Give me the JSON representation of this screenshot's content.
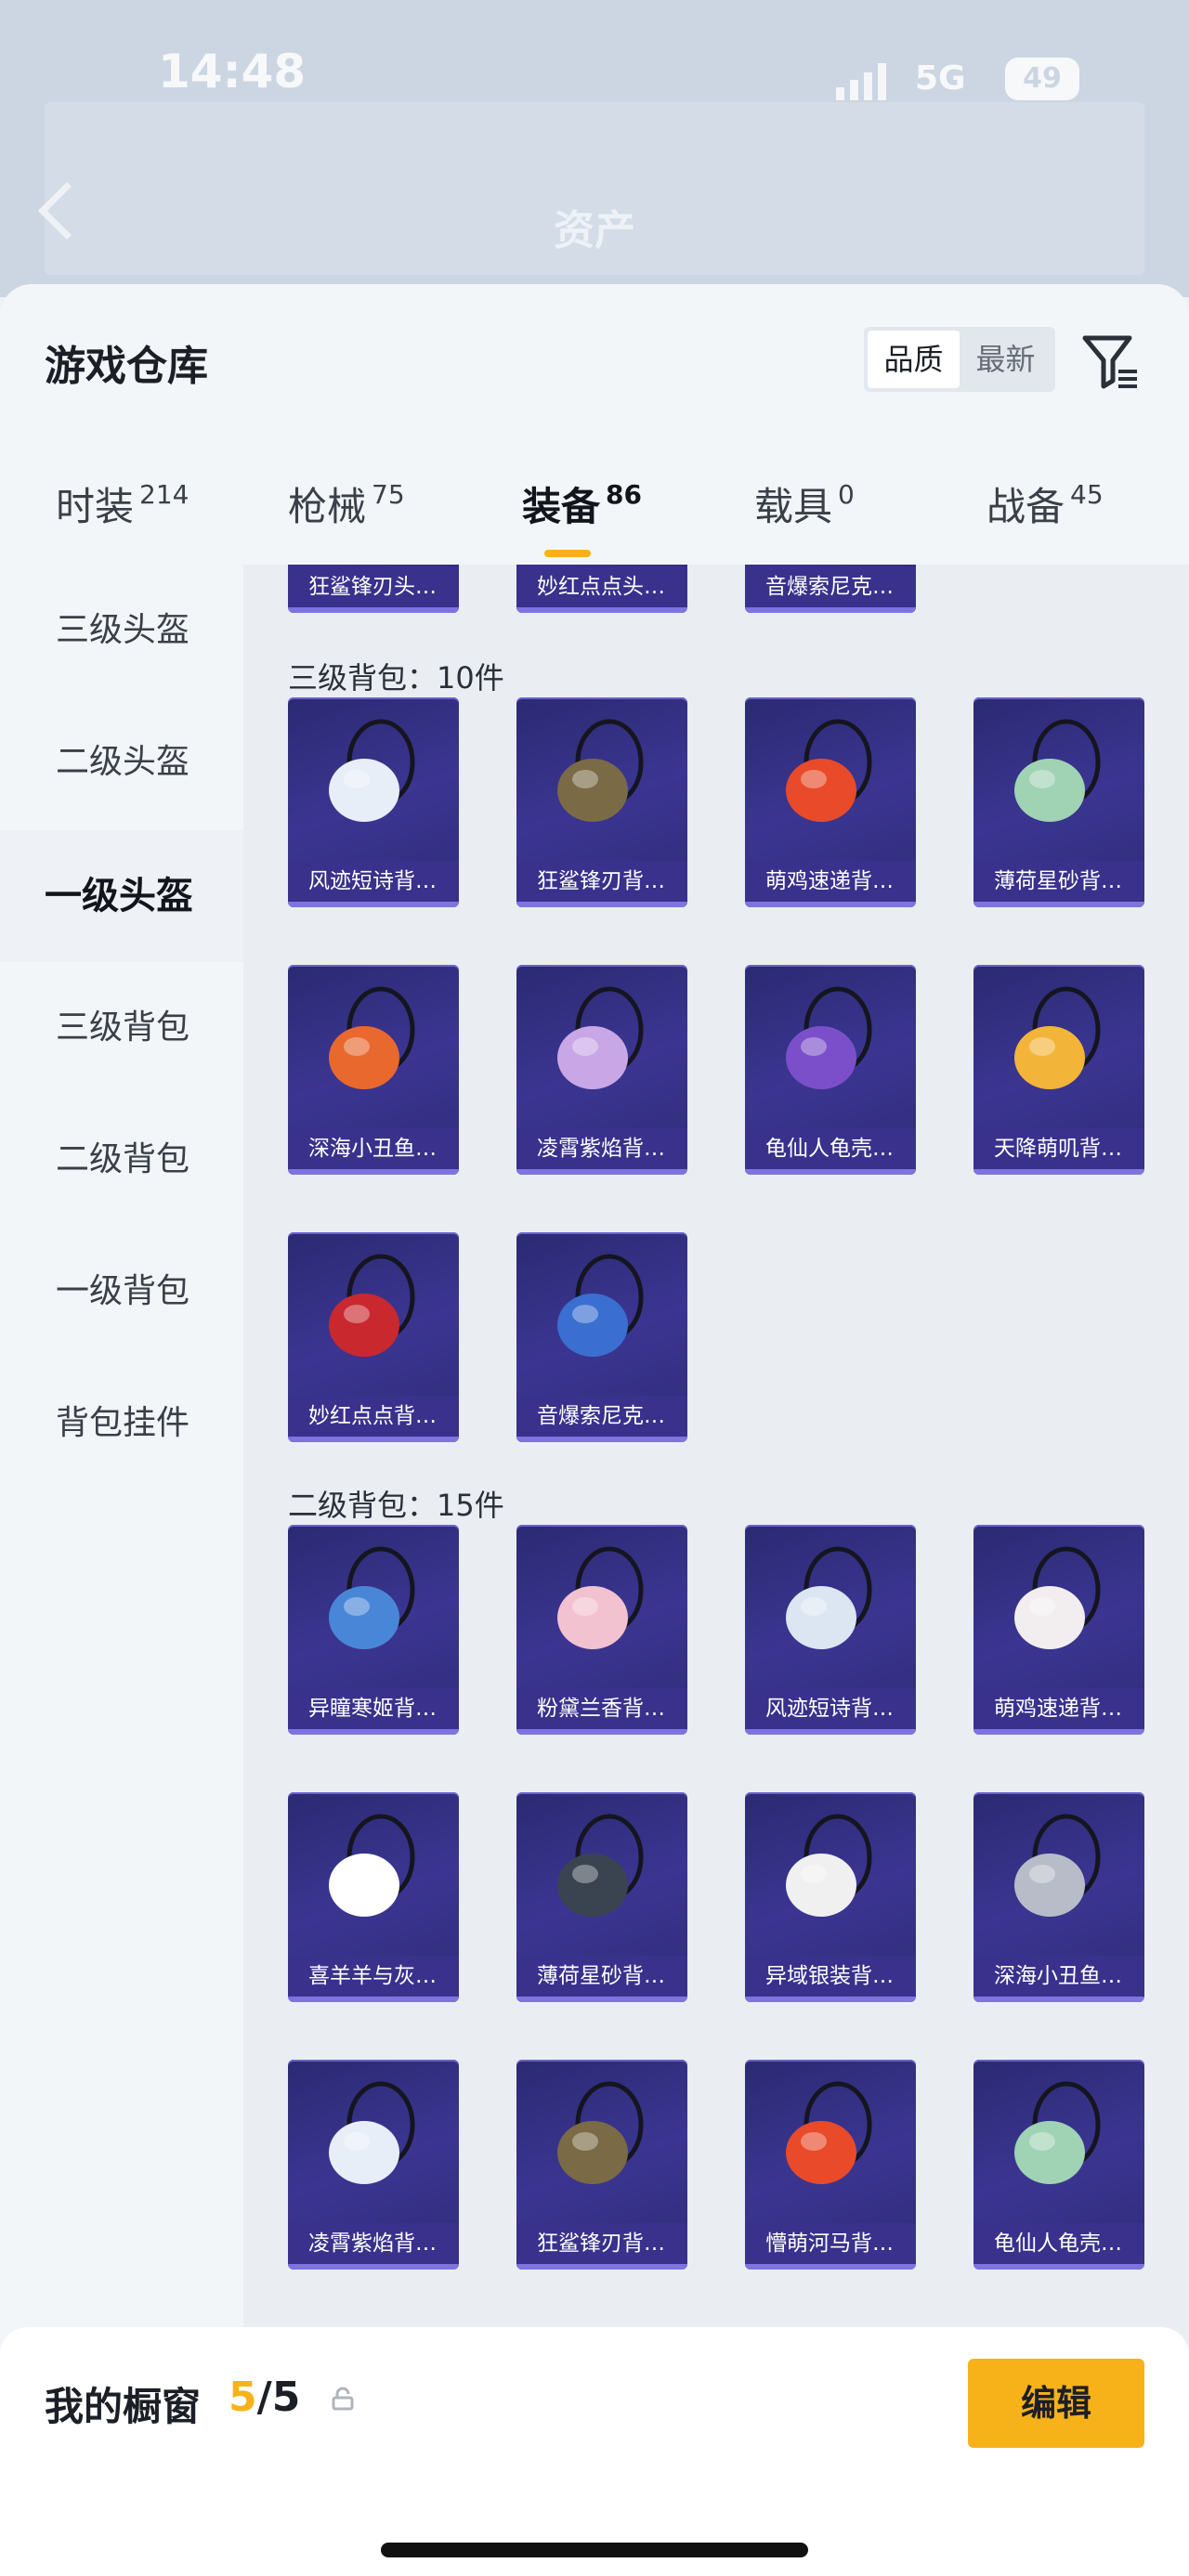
{
  "status_bar": {
    "time": "14:48",
    "network": "5G",
    "battery": "49"
  },
  "app_header": {
    "title": "资产"
  },
  "sheet": {
    "title": "游戏仓库",
    "sort_options": [
      "品质",
      "最新"
    ],
    "active_sort": "品质"
  },
  "tabs": [
    {
      "label": "时装",
      "count": "214"
    },
    {
      "label": "枪械",
      "count": "75"
    },
    {
      "label": "装备",
      "count": "86"
    },
    {
      "label": "载具",
      "count": "0"
    },
    {
      "label": "战备",
      "count": "45"
    }
  ],
  "active_tab": "装备",
  "sidebar": {
    "items": [
      "三级头盔",
      "二级头盔",
      "一级头盔",
      "三级背包",
      "二级背包",
      "一级背包",
      "背包挂件"
    ],
    "active": "一级头盔"
  },
  "top_partial_row": [
    "狂鲨锋刃头…",
    "妙红点点头…",
    "音爆索尼克…"
  ],
  "sections": [
    {
      "title": "三级背包：10件",
      "items": [
        "风迹短诗背…",
        "狂鲨锋刃背…",
        "萌鸡速递背…",
        "薄荷星砂背…",
        "深海小丑鱼…",
        "凌霄紫焰背…",
        "龟仙人龟壳…",
        "天降萌叽背…",
        "妙红点点背…",
        "音爆索尼克…"
      ]
    },
    {
      "title": "二级背包：15件",
      "items": [
        "异瞳寒姬背…",
        "粉黛兰香背…",
        "风迹短诗背…",
        "萌鸡速递背…",
        "喜羊羊与灰…",
        "薄荷星砂背…",
        "异域银装背…",
        "深海小丑鱼…",
        "凌霄紫焰背…",
        "狂鲨锋刃背…",
        "懵萌河马背…",
        "龟仙人龟壳…"
      ]
    }
  ],
  "showcase": {
    "label": "我的橱窗",
    "used": "5",
    "total": "/5",
    "edit_label": "编辑"
  },
  "colors": {
    "accent": "#f7b21a",
    "card_bg": "#2f2c7a",
    "card_name_bg": "#3a328c"
  },
  "icons": [
    "back-chevron-icon",
    "filter-funnel-icon",
    "lock-icon",
    "share-external-icon"
  ]
}
